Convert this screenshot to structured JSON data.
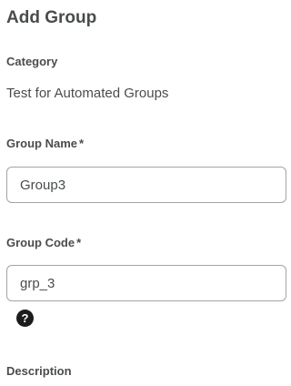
{
  "page": {
    "title": "Add Group"
  },
  "category": {
    "label": "Category",
    "value": "Test for Automated Groups"
  },
  "group_name": {
    "label": "Group Name",
    "required_marker": "*",
    "value": "Group3"
  },
  "group_code": {
    "label": "Group Code",
    "required_marker": "*",
    "value": "grp_3",
    "help_icon_glyph": "?"
  },
  "description": {
    "label": "Description"
  }
}
